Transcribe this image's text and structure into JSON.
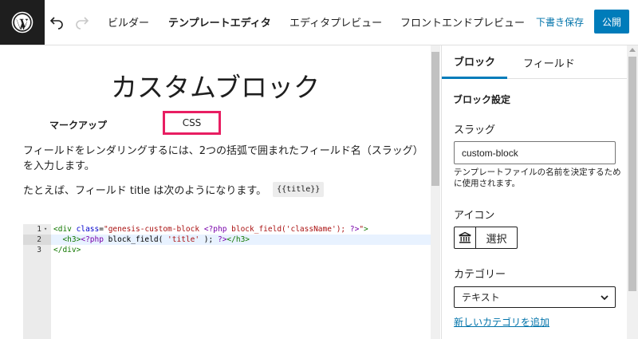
{
  "colors": {
    "accent": "#007cba",
    "highlight": "#e81e62",
    "link": "#0073aa",
    "logo_bg": "#1e1e1e"
  },
  "header": {
    "logo_icon": "wordpress-icon",
    "undo_icon": "undo-icon",
    "redo_icon": "redo-icon",
    "tabs": [
      {
        "label": "ビルダー"
      },
      {
        "label": "テンプレートエディタ"
      },
      {
        "label": "エディタプレビュー"
      },
      {
        "label": "フロントエンドプレビュー"
      }
    ],
    "save_draft": "下書き保存",
    "publish": "公開"
  },
  "main": {
    "title": "カスタムブロック",
    "subtabs": {
      "markup": "マークアップ",
      "css": "CSS"
    },
    "help_text": "フィールドをレンダリングするには、2つの括弧で囲まれたフィールド名（スラッグ）を入力します。",
    "example_text": "たとえば、フィールド title は次のようになります。",
    "example_code": "{{title}}",
    "code_lines": [
      {
        "num": "1",
        "text": "<div class=\"genesis-custom-block <?php block_field('className'); ?>\">"
      },
      {
        "num": "2",
        "text": "  <h3><?php block_field( 'title' ); ?></h3>"
      },
      {
        "num": "3",
        "text": "</div>"
      }
    ]
  },
  "sidebar": {
    "tabs": [
      {
        "label": "ブロック"
      },
      {
        "label": "フィールド"
      }
    ],
    "section_title": "ブロック設定",
    "slug_label": "スラッグ",
    "slug_value": "custom-block",
    "slug_help": "テンプレートファイルの名前を決定するために使用されます。",
    "icon_label": "アイコン",
    "icon_name": "bank-icon",
    "icon_button": "選択",
    "category_label": "カテゴリー",
    "category_value": "テキスト",
    "new_category_link": "新しいカテゴリを追加"
  }
}
